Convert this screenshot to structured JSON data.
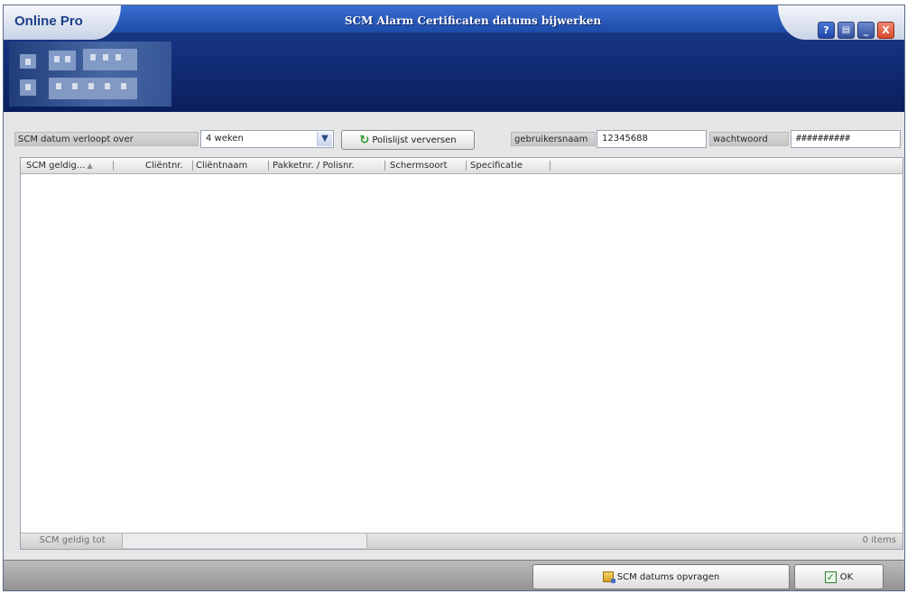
{
  "window": {
    "brand": "Online Pro",
    "title": "SCM Alarm Certificaten datums bijwerken",
    "buttons": {
      "help": "?",
      "doc": "▤",
      "minimize": "_",
      "close": "X"
    }
  },
  "controls": {
    "expiry_label": "SCM datum verloopt over",
    "expiry_value": "4 weken",
    "refresh_button": "Polislijst verversen",
    "username_label": "gebruikersnaam",
    "username_value": "12345688",
    "password_label": "wachtwoord",
    "password_value": "##########"
  },
  "grid": {
    "columns": [
      "SCM geldig...",
      "Cliëntnr.",
      "Cliëntnaam",
      "Pakketnr. / Polisnr.",
      "Schermsoort",
      "Specificatie"
    ],
    "rows": [],
    "footer": {
      "group_label": "SCM geldig tot",
      "count": "0 items"
    }
  },
  "actions": {
    "request_button": "SCM datums opvragen",
    "ok_button": "OK"
  },
  "colors": {
    "header": "#14327e",
    "title_bar": "#2d5cbd",
    "accent_green": "#2e9a2e"
  }
}
